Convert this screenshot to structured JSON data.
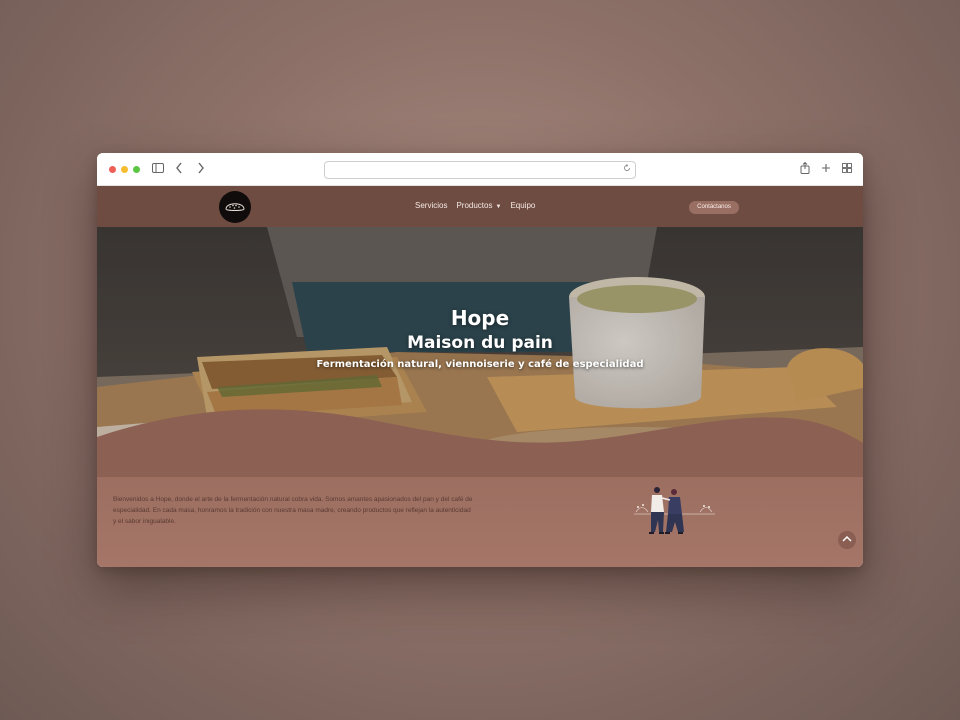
{
  "browser": {
    "url": "",
    "icons": [
      "sidebar-icon",
      "back-icon",
      "forward-icon",
      "reload-icon",
      "share-icon",
      "new-tab-icon",
      "tab-overview-icon"
    ]
  },
  "navbar": {
    "links": [
      "Servicios",
      "Productos",
      "Equipo"
    ],
    "cta": "Contáctanos"
  },
  "hero": {
    "title": "Hope",
    "subtitle": "Maison du pain",
    "tagline": "Fermentación natural, viennoiserie y café de especialidad"
  },
  "about": {
    "text": "Bienvenidos a Hope, donde el arte de la fermentación natural cobra vida. Somos amantes apasionados del pan y del café de especialidad. En cada masa, honramos la tradición con nuestra masa madre, creando productos que reflejan la autenticidad y el sabor inigualable."
  },
  "colors": {
    "navbar": "#6f4c42",
    "button": "#9a6f63",
    "page_top": "#7a5549",
    "page_bottom": "#a57668"
  }
}
